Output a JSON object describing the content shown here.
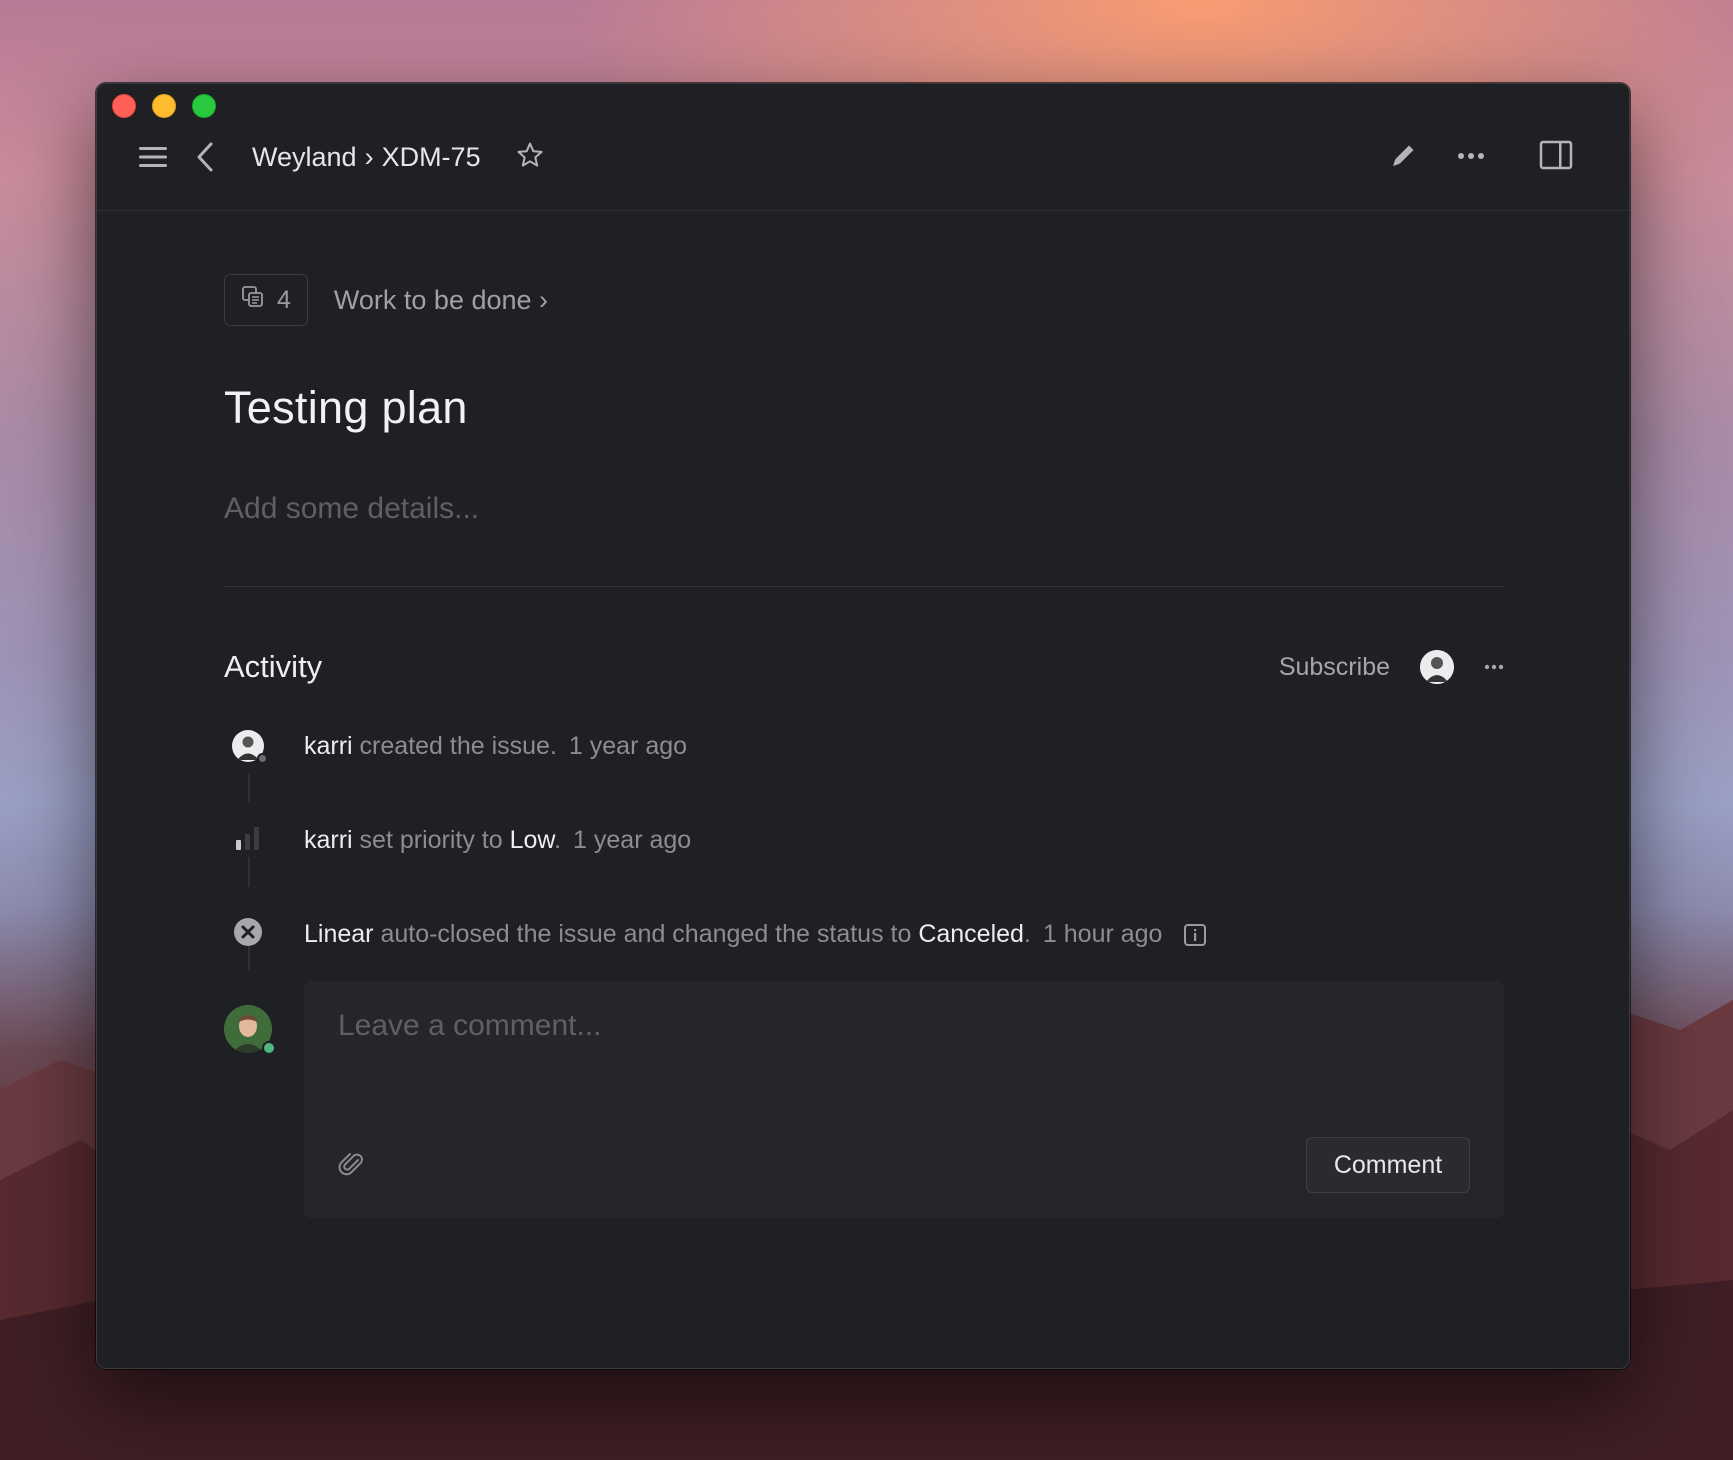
{
  "header": {
    "team": "Weyland",
    "separator": "›",
    "issue_id": "XDM-75",
    "icons": [
      "menu-icon",
      "back-icon",
      "star-icon",
      "pencil-icon",
      "more-icon",
      "sidebar-panel-icon"
    ]
  },
  "issue": {
    "subissue_count": "4",
    "parent_label": "Work to be done ›",
    "title": "Testing plan",
    "description_placeholder": "Add some details..."
  },
  "activity": {
    "heading": "Activity",
    "subscribe_label": "Subscribe",
    "more_label": "···",
    "events": [
      {
        "actor": "karri",
        "text": " created the issue.",
        "time": "1 year ago"
      },
      {
        "actor": "karri",
        "text": " set priority to ",
        "value": "Low",
        "end": ".",
        "time": "1 year ago"
      },
      {
        "actor": "Linear",
        "text": " auto-closed the issue and changed the status to ",
        "value": "Canceled",
        "end": ".",
        "time": "1 hour ago"
      }
    ]
  },
  "comment": {
    "placeholder": "Leave a comment...",
    "button_label": "Comment"
  },
  "colors": {
    "background": "#1f2023",
    "online": "#4cb782",
    "traffic_red": "#fe5f57",
    "traffic_yellow": "#febc2e",
    "traffic_green": "#28c840"
  }
}
